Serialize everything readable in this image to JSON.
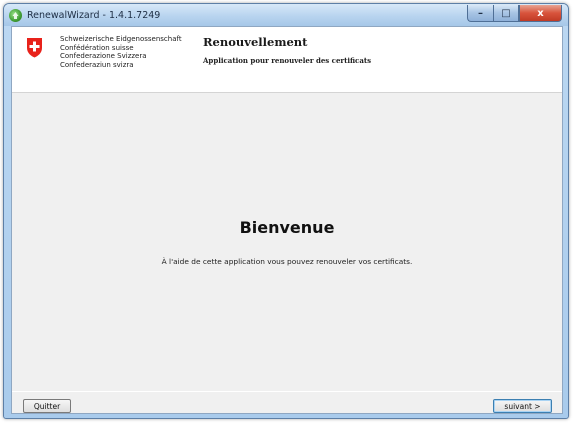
{
  "window": {
    "title": "RenewalWizard - 1.4.1.7249",
    "controls": {
      "minimize": "–",
      "maximize": "□",
      "close": "x"
    }
  },
  "header": {
    "confederation": [
      "Schweizerische Eidgenossenschaft",
      "Confédération suisse",
      "Confederazione Svizzera",
      "Confederaziun svizra"
    ],
    "title": "Renouvellement",
    "subtitle": "Application pour renouveler des certificats"
  },
  "content": {
    "heading": "Bienvenue",
    "text": "À l'aide de cette application vous pouvez renouveler vos certificats."
  },
  "buttons": {
    "quit": "Quitter",
    "next": "suivant >"
  },
  "colors": {
    "flag_red": "#e8221b",
    "titlebar": "#b8d4ef",
    "close_button": "#d8543c"
  },
  "icons": {
    "app": "green-recycle-icon",
    "flag": "swiss-flag-icon"
  }
}
